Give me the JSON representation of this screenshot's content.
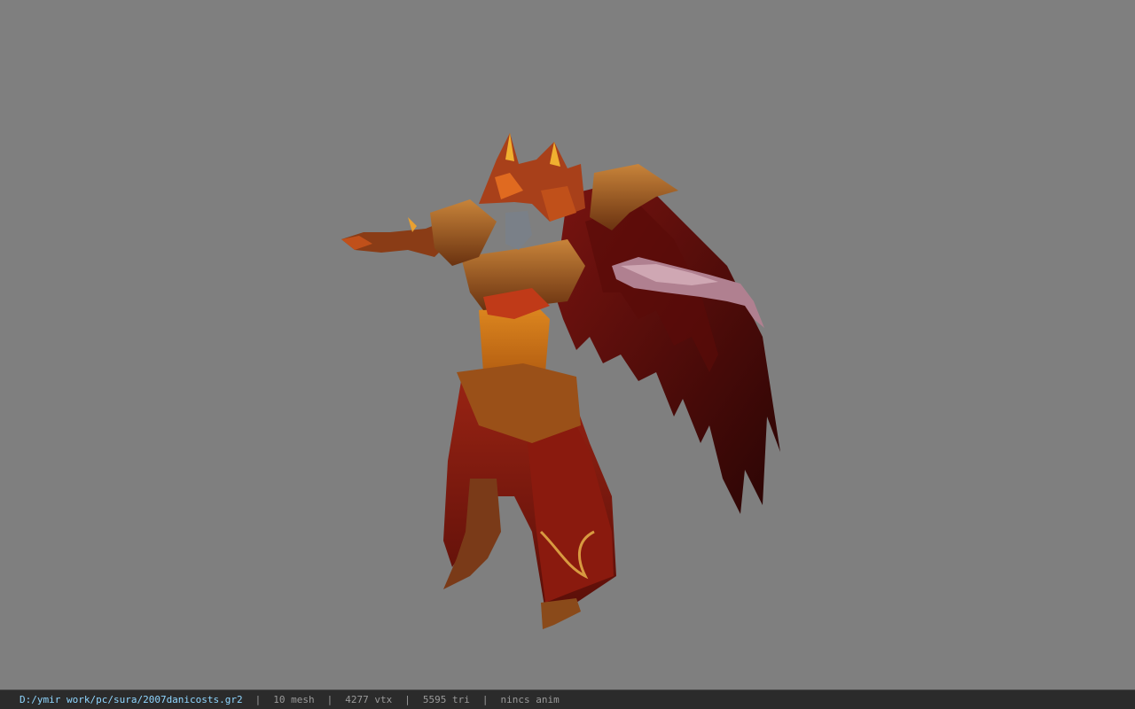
{
  "status_bar": {
    "file_path": "D:/ymir work/pc/sura/2007danicosts.gr2",
    "separator": "|",
    "mesh_count": "10 mesh",
    "vertex_count": "4277 vtx",
    "triangle_count": "5595 tri",
    "anim_status": "nincs anim"
  },
  "viewport": {
    "background_color": "#7f7f7f",
    "model": "armored-winged-warrior-3d-model"
  }
}
